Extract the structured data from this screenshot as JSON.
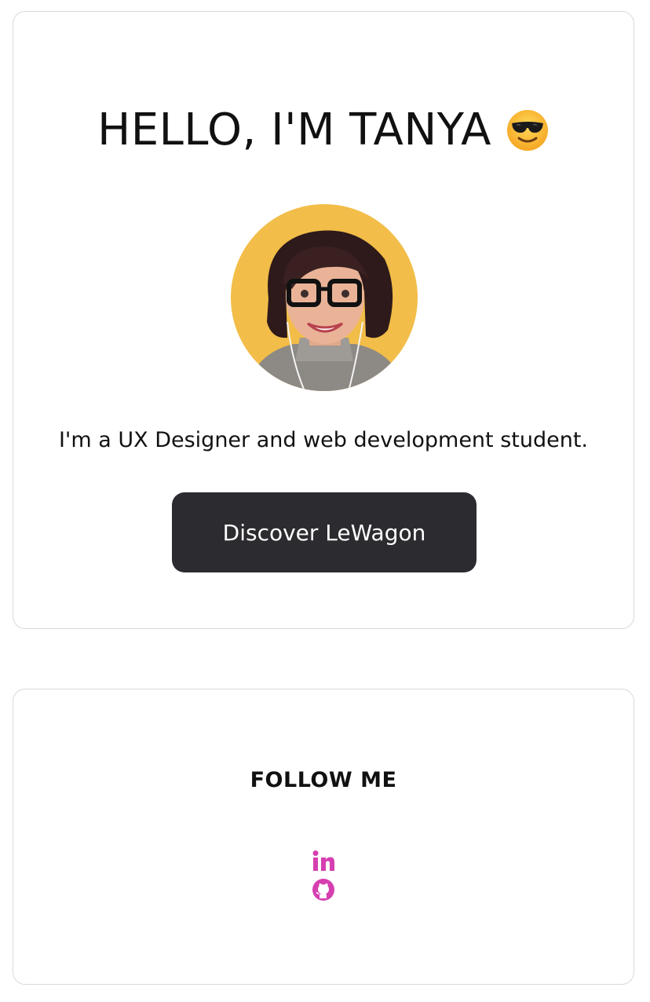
{
  "hero": {
    "title": "HELLO, I'M TANYA",
    "title_emoji_icon": "sunglasses-face-icon",
    "avatar_alt": "Portrait of Tanya",
    "tagline": "I'm a UX Designer and web development student.",
    "cta_label": "Discover LeWagon"
  },
  "follow": {
    "title": "FOLLOW ME",
    "links": [
      {
        "icon": "linkedin-icon",
        "label": "LinkedIn"
      },
      {
        "icon": "github-icon",
        "label": "GitHub"
      }
    ]
  },
  "colors": {
    "accent": "#d63fb0",
    "button_bg": "#2b2b30",
    "avatar_bg": "#f2bd48",
    "border": "#d9d9d9",
    "text": "#111111"
  }
}
